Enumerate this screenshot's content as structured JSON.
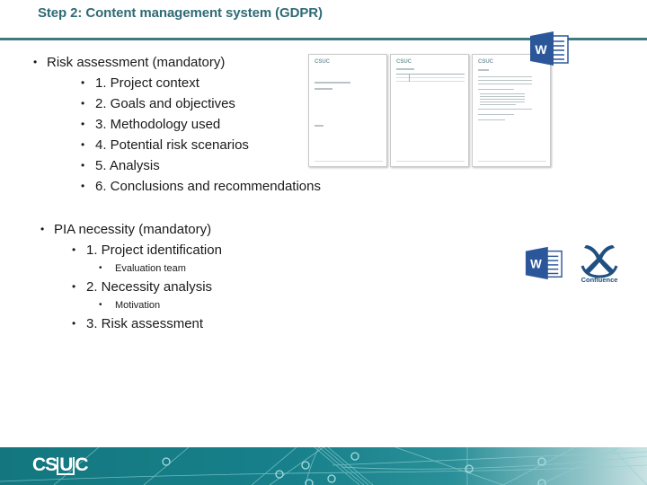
{
  "slide": {
    "title": "Step 2: Content management system (GDPR)"
  },
  "risk_assessment": {
    "heading": "Risk assessment (mandatory)",
    "items": [
      "1. Project context",
      "2. Goals and objectives",
      "3. Methodology used",
      "4. Potential risk scenarios",
      "5. Analysis",
      "6. Conclusions and recommendations"
    ]
  },
  "pia_necessity": {
    "heading": "PIA necessity (mandatory)",
    "items": [
      {
        "label": "1. Project identification",
        "sub": "Evaluation team"
      },
      {
        "label": "2. Necessity analysis",
        "sub": "Motivation"
      },
      {
        "label": "3. Risk assessment",
        "sub": null
      }
    ]
  },
  "thumbnails": {
    "pages": [
      {
        "logo": "CSUC"
      },
      {
        "logo": "CSUC"
      },
      {
        "logo": "CSUC"
      }
    ]
  },
  "icons": {
    "word_top": "microsoft-word-icon",
    "word_mid": "microsoft-word-icon",
    "confluence": "confluence-icon",
    "word_letter": "W",
    "confluence_label": "Confluence"
  },
  "footer": {
    "logo_pre": "CS",
    "logo_u": "U",
    "logo_post": "C"
  },
  "colors": {
    "title": "#2e6b75",
    "rule": "#3f7a80",
    "footer": "#14777f",
    "word_blue": "#2b579a",
    "confluence_blue": "#205081"
  }
}
